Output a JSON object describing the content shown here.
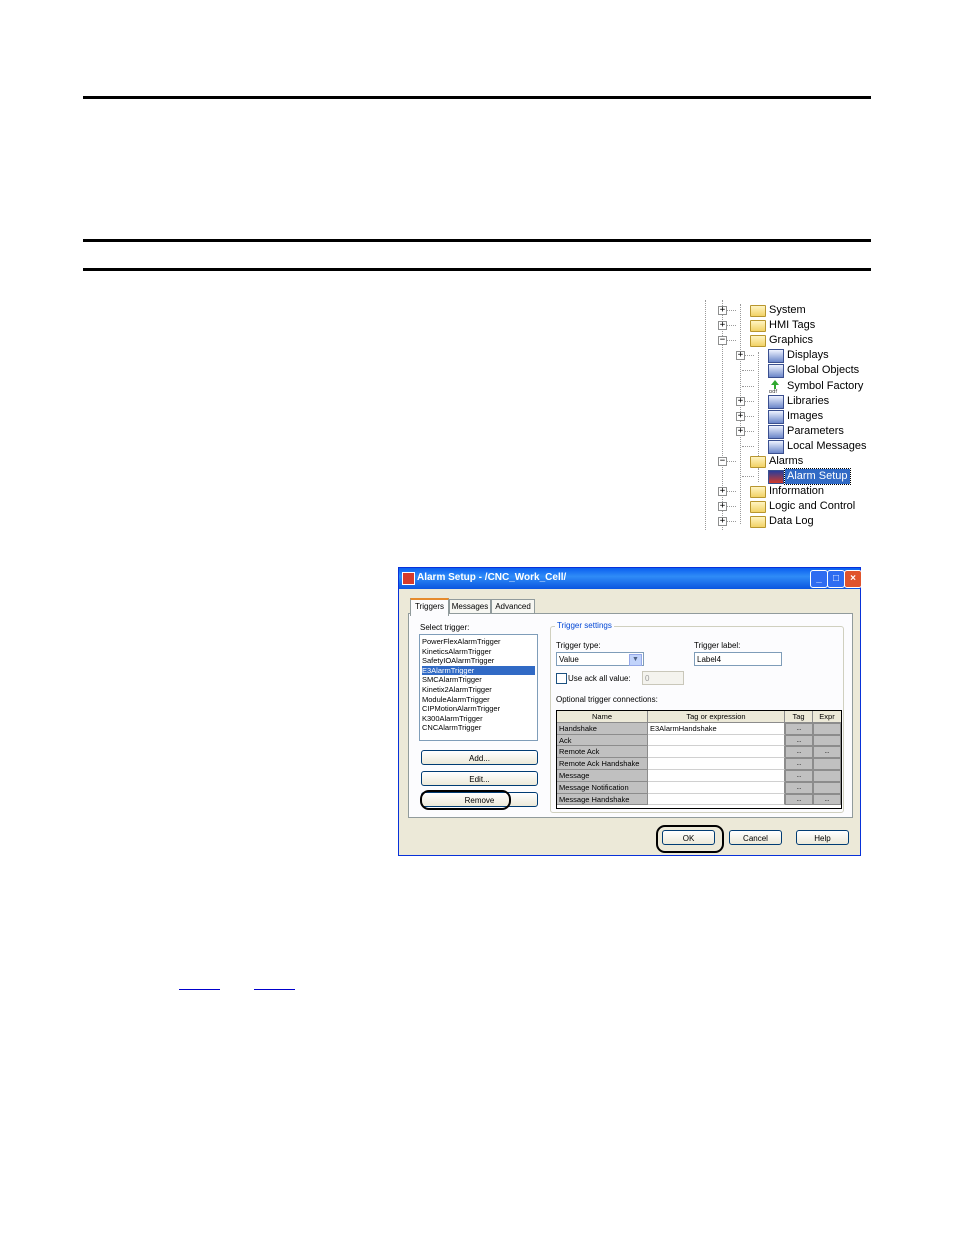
{
  "tree": {
    "items": [
      {
        "label": "System",
        "icon": "folder-icon",
        "expander": "+",
        "selected": false
      },
      {
        "label": "HMI Tags",
        "icon": "folder-icon",
        "expander": "+",
        "selected": false
      },
      {
        "label": "Graphics",
        "icon": "open-folder-icon",
        "expander": "−",
        "selected": false
      },
      {
        "label": "Displays",
        "icon": "displays-icon",
        "expander": "+",
        "selected": false
      },
      {
        "label": "Global Objects",
        "icon": "global-objects-icon",
        "expander": "",
        "selected": false
      },
      {
        "label": "Symbol Factory",
        "icon": "symbol-factory-icon",
        "expander": "",
        "selected": false
      },
      {
        "label": "Libraries",
        "icon": "libraries-icon",
        "expander": "+",
        "selected": false
      },
      {
        "label": "Images",
        "icon": "images-icon",
        "expander": "+",
        "selected": false
      },
      {
        "label": "Parameters",
        "icon": "parameters-icon",
        "expander": "+",
        "selected": false
      },
      {
        "label": "Local Messages",
        "icon": "local-messages-icon",
        "expander": "",
        "selected": false
      },
      {
        "label": "Alarms",
        "icon": "open-folder-icon",
        "expander": "−",
        "selected": false
      },
      {
        "label": "Alarm Setup",
        "icon": "alarm-setup-icon",
        "expander": "",
        "selected": true
      },
      {
        "label": "Information",
        "icon": "folder-icon",
        "expander": "+",
        "selected": false
      },
      {
        "label": "Logic and Control",
        "icon": "folder-icon",
        "expander": "+",
        "selected": false
      },
      {
        "label": "Data Log",
        "icon": "folder-icon",
        "expander": "+",
        "selected": false
      }
    ]
  },
  "dialog": {
    "title": "Alarm Setup - /CNC_Work_Cell/",
    "title_buttons": {
      "minimize": "_",
      "maximize": "□",
      "close": "×"
    },
    "tabs": [
      "Triggers",
      "Messages",
      "Advanced"
    ],
    "active_tab": "Triggers",
    "select_trigger_label": "Select trigger:",
    "triggers": [
      "PowerFlexAlarmTrigger",
      "KineticsAlarmTrigger",
      "SafetyIOAlarmTrigger",
      "E3AlarmTrigger",
      "SMCAlarmTrigger",
      "Kinetix2AlarmTrigger",
      "ModuleAlarmTrigger",
      "CIPMotionAlarmTrigger",
      "K300AlarmTrigger",
      "CNCAlarmTrigger"
    ],
    "selected_trigger": "E3AlarmTrigger",
    "add_label": "Add...",
    "edit_label": "Edit...",
    "remove_label": "Remove",
    "settings_legend": "Trigger settings",
    "trigger_type_label": "Trigger type:",
    "trigger_type_value": "Value",
    "trigger_label_label": "Trigger label:",
    "trigger_label_value": "Label4",
    "use_ack_label": "Use ack all value:",
    "use_ack_value": "0",
    "optional_label": "Optional trigger connections:",
    "grid_headers": [
      "Name",
      "Tag or expression",
      "Tag",
      "Expr"
    ],
    "grid_rows": [
      {
        "name": "Handshake",
        "value": "E3AlarmHandshake",
        "tag": "...",
        "expr": ""
      },
      {
        "name": "Ack",
        "value": "",
        "tag": "...",
        "expr": ""
      },
      {
        "name": "Remote Ack",
        "value": "",
        "tag": "...",
        "expr": "..."
      },
      {
        "name": "Remote Ack Handshake",
        "value": "",
        "tag": "...",
        "expr": ""
      },
      {
        "name": "Message",
        "value": "",
        "tag": "...",
        "expr": ""
      },
      {
        "name": "Message Notification",
        "value": "",
        "tag": "...",
        "expr": ""
      },
      {
        "name": "Message Handshake",
        "value": "",
        "tag": "...",
        "expr": "..."
      }
    ],
    "ok_label": "OK",
    "cancel_label": "Cancel",
    "help_label": "Help"
  },
  "links": [
    "",
    ""
  ]
}
